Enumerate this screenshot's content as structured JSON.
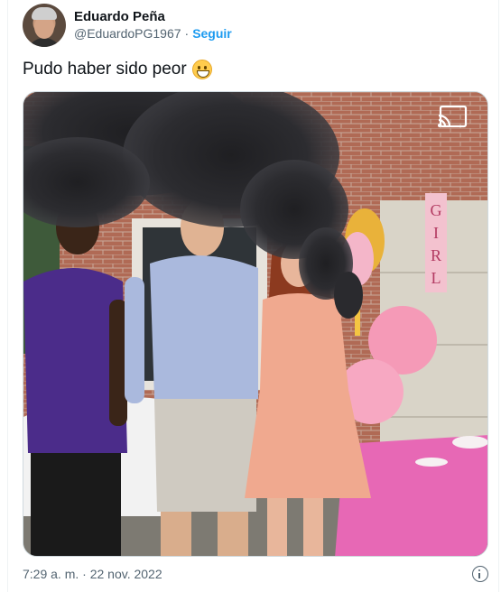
{
  "author": {
    "display_name": "Eduardo Peña",
    "handle": "@EduardoPG1967",
    "separator": "·",
    "follow_label": "Seguir"
  },
  "tweet": {
    "text": "Pudo haber sido peor",
    "emoji": "grinning-face-with-smiling-eyes"
  },
  "media": {
    "sign_letters": [
      "G",
      "I",
      "R",
      "L"
    ],
    "cast_icon": "cast-icon"
  },
  "footer": {
    "timestamp": "7:29 a. m. · 22 nov. 2022",
    "info_icon": "info-icon"
  },
  "colors": {
    "accent": "#1d9bf0",
    "secondary_text": "#536471",
    "border": "#cfd9de"
  }
}
